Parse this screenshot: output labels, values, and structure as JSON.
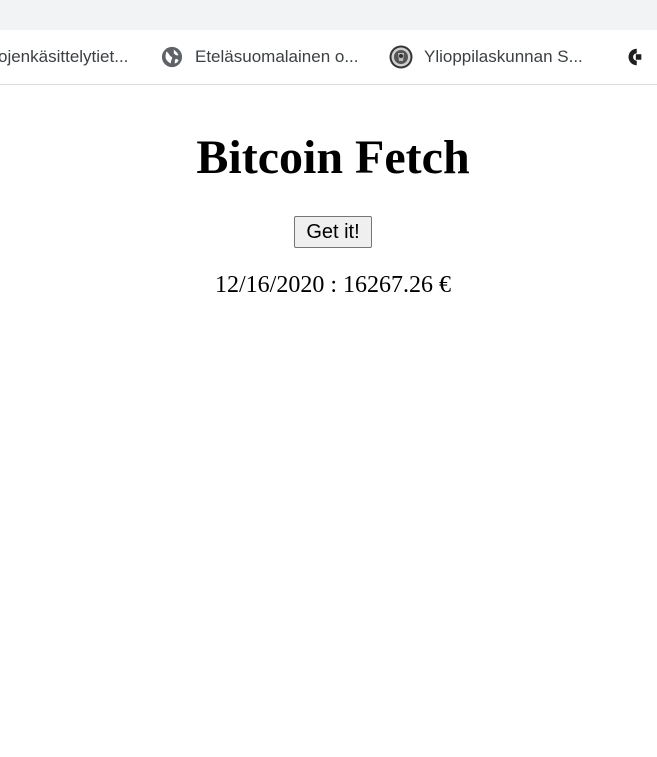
{
  "bookmarks": [
    {
      "label": "ojenkäsittelytiet...",
      "icon": "none"
    },
    {
      "label": "Eteläsuomalainen o...",
      "icon": "globe-icon"
    },
    {
      "label": "Ylioppilaskunnan S...",
      "icon": "seal-icon"
    },
    {
      "label": "",
      "icon": "site-logo-icon"
    }
  ],
  "page": {
    "title": "Bitcoin Fetch",
    "button_label": "Get it!",
    "result": {
      "date": "12/16/2020",
      "separator": ":",
      "price": "16267.26",
      "currency": "€"
    }
  },
  "colors": {
    "tab_strip": "#f1f3f4",
    "bookmark_text": "#3c4043",
    "divider": "#dadce0"
  }
}
